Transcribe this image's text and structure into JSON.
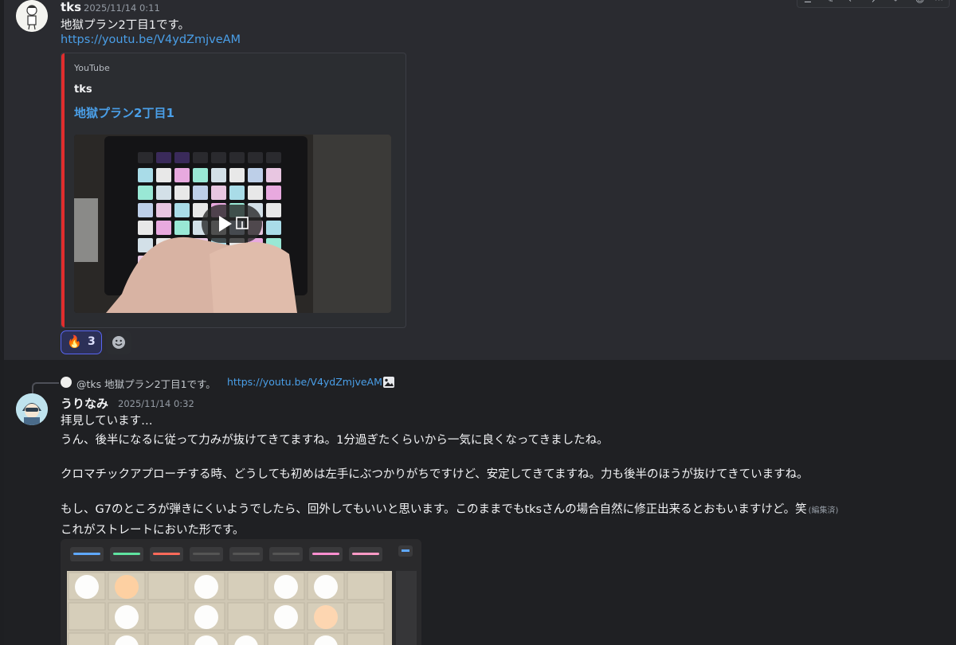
{
  "message1": {
    "author": "tks",
    "timestamp": "2025/11/14 0:11",
    "text": "地獄プラン2丁目1です。",
    "link": "https://youtu.be/V4ydZmjveAM",
    "embed": {
      "provider": "YouTube",
      "author": "tks",
      "title": "地獄プラン2丁目1",
      "bar_color": "#e02d2d"
    },
    "reaction": {
      "emoji": "🔥",
      "count": "3"
    }
  },
  "message2": {
    "reply": {
      "mention": "@tks",
      "text": "地獄プラン2丁目1です。",
      "link": "https://youtu.be/V4ydZmjveAM"
    },
    "author": "うりなみ",
    "timestamp": "2025/11/14 0:32",
    "lines": [
      "拝見しています…",
      "うん、後半になるに従って力みが抜けてきてますね。1分過ぎたくらいから一気に良くなってきましたね。",
      "クロマチックアプローチする時、どうしても初めは左手にぶつかりがちですけど、安定してきてますね。力も後半のほうが抜けてきていますね。",
      "もし、G7のところが弾きにくいようでしたら、回外してもいいと思います。このままでもtksさんの場合自然に修正出来るとおもいますけど。笑",
      "これがストレートにおいた形です。"
    ],
    "edited": "(編集済)"
  },
  "colors": {
    "link": "#4a9fe8",
    "reaction_border": "#5865f2"
  }
}
